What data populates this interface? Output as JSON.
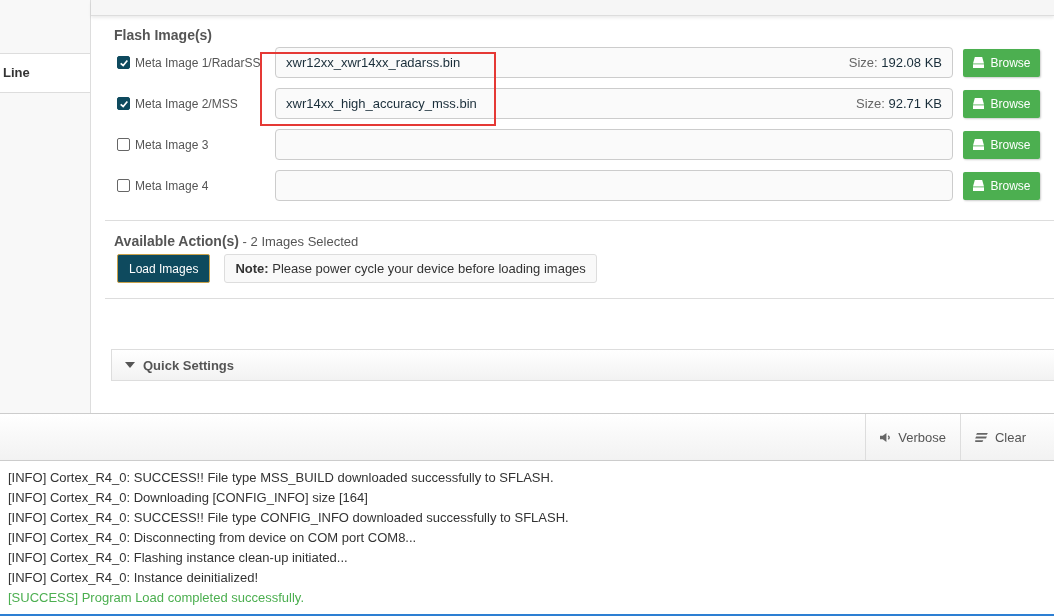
{
  "sidebar": {
    "items": [
      {
        "label": "Line",
        "selected": false
      }
    ]
  },
  "flash_images": {
    "title": "Flash Image(s)",
    "rows": [
      {
        "label": "Meta Image 1/RadarSS",
        "checked": true,
        "file": "xwr12xx_xwr14xx_radarss.bin",
        "size_label": "Size:",
        "size": "192.08 KB",
        "button": "Browse"
      },
      {
        "label": "Meta Image 2/MSS",
        "checked": true,
        "file": "xwr14xx_high_accuracy_mss.bin",
        "size_label": "Size:",
        "size": "92.71 KB",
        "button": "Browse"
      },
      {
        "label": "Meta Image 3",
        "checked": false,
        "button": "Browse"
      },
      {
        "label": "Meta Image 4",
        "checked": false,
        "button": "Browse"
      }
    ]
  },
  "actions": {
    "title": "Available Action(s)",
    "subtitle": "- 2 Images Selected",
    "button": "Load Images",
    "note": "**Note:** Please power cycle your device before loading images"
  },
  "quick_settings": {
    "title": "Quick Settings",
    "expanded": true
  },
  "console": {
    "buttons": [
      {
        "label": "Verbose",
        "kind": "speaker"
      },
      {
        "label": "Clear",
        "kind": "lines"
      }
    ],
    "lines": [
      {
        "kind": "info",
        "text": "[INFO] Cortex_R4_0: SUCCESS!! File type MSS_BUILD downloaded successfully to SFLASH."
      },
      {
        "kind": "info",
        "text": "[INFO] Cortex_R4_0: Downloading [CONFIG_INFO] size [164]"
      },
      {
        "kind": "info",
        "text": "[INFO] Cortex_R4_0: SUCCESS!! File type CONFIG_INFO downloaded successfully to SFLASH."
      },
      {
        "kind": "info",
        "text": "[INFO] Cortex_R4_0: Disconnecting from device on COM port COM8..."
      },
      {
        "kind": "info",
        "text": "[INFO] Cortex_R4_0: Flashing instance clean-up initiated..."
      },
      {
        "kind": "info",
        "text": "[INFO] Cortex_R4_0: Instance deinitialized!"
      },
      {
        "kind": "success",
        "text": "[SUCCESS] Program Load completed successfully."
      }
    ]
  }
}
